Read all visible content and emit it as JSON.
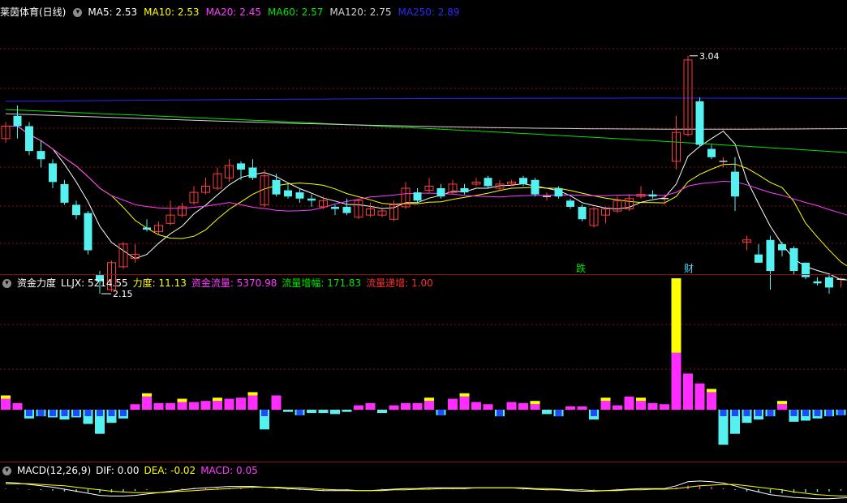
{
  "panel_price": {
    "title": "莱茵体育(日线)",
    "ma": [
      {
        "label": "MA5: 2.53",
        "color": "#ffffff"
      },
      {
        "label": "MA10: 2.53",
        "color": "#ffff00"
      },
      {
        "label": "MA20: 2.45",
        "color": "#ff3dff"
      },
      {
        "label": "MA60: 2.57",
        "color": "#00e600"
      },
      {
        "label": "MA120: 2.75",
        "color": "#d0d0d0"
      },
      {
        "label": "MA250: 2.89",
        "color": "#2a2aff"
      }
    ],
    "high_label": "3.04",
    "low_label": "2.15",
    "marks": [
      {
        "text": "跌",
        "color": "#00e600"
      },
      {
        "text": "财",
        "color": "#55d8ff"
      }
    ]
  },
  "panel_flow": {
    "title": "资金力度",
    "fields": [
      {
        "label": "LLJX: 5214.55",
        "color": "#ffffff"
      },
      {
        "label": "力度: 11.13",
        "color": "#ffff00"
      },
      {
        "label": "资金流量: 5370.98",
        "color": "#ff3dff"
      },
      {
        "label": "流量增幅: 171.83",
        "color": "#00e600"
      },
      {
        "label": "流量递增: 1.00",
        "color": "#ff3030"
      }
    ]
  },
  "panel_macd": {
    "title": "MACD(12,26,9)",
    "fields": [
      {
        "label": "DIF: 0.00",
        "color": "#ffffff"
      },
      {
        "label": "DEA: -0.02",
        "color": "#ffff00"
      },
      {
        "label": "MACD: 0.05",
        "color": "#ff3dff"
      }
    ]
  },
  "colors": {
    "up": "#ff3b3b",
    "down": "#55f0f0",
    "grid": "#8c1010",
    "flow_pos": "#ff2dff",
    "flow_pos_ext": "#ffff00",
    "flow_neg": "#55f0f0",
    "flow_neg_core": "#1e4bff"
  },
  "chart_data": {
    "type": "candlestick",
    "price_range": [
      2.0,
      3.2
    ],
    "candles": [
      [
        2.64,
        2.7,
        2.72,
        2.62
      ],
      [
        2.75,
        2.7,
        2.8,
        2.64
      ],
      [
        2.7,
        2.58,
        2.72,
        2.56
      ],
      [
        2.58,
        2.54,
        2.63,
        2.5
      ],
      [
        2.52,
        2.43,
        2.54,
        2.4
      ],
      [
        2.42,
        2.33,
        2.44,
        2.32
      ],
      [
        2.32,
        2.27,
        2.34,
        2.25
      ],
      [
        2.28,
        2.1,
        2.29,
        2.08
      ],
      [
        1.98,
        1.95,
        2.0,
        1.89
      ],
      [
        1.91,
        2.04,
        2.05,
        1.9
      ],
      [
        2.02,
        2.13,
        2.14,
        2.01
      ],
      [
        2.06,
        2.08,
        2.13,
        2.04
      ],
      [
        2.21,
        2.2,
        2.25,
        2.19
      ],
      [
        2.19,
        2.22,
        2.24,
        2.18
      ],
      [
        2.23,
        2.27,
        2.34,
        2.22
      ],
      [
        2.27,
        2.31,
        2.33,
        2.26
      ],
      [
        2.33,
        2.38,
        2.41,
        2.32
      ],
      [
        2.38,
        2.41,
        2.45,
        2.37
      ],
      [
        2.4,
        2.47,
        2.5,
        2.39
      ],
      [
        2.45,
        2.51,
        2.54,
        2.43
      ],
      [
        2.52,
        2.49,
        2.53,
        2.44
      ],
      [
        2.5,
        2.45,
        2.54,
        2.44
      ],
      [
        2.32,
        2.46,
        2.49,
        2.31
      ],
      [
        2.44,
        2.37,
        2.47,
        2.36
      ],
      [
        2.39,
        2.36,
        2.42,
        2.35
      ],
      [
        2.38,
        2.35,
        2.4,
        2.33
      ],
      [
        2.35,
        2.34,
        2.37,
        2.31
      ],
      [
        2.31,
        2.34,
        2.36,
        2.3
      ],
      [
        2.31,
        2.3,
        2.32,
        2.27
      ],
      [
        2.31,
        2.28,
        2.35,
        2.27
      ],
      [
        2.26,
        2.34,
        2.35,
        2.25
      ],
      [
        2.27,
        2.3,
        2.33,
        2.26
      ],
      [
        2.27,
        2.29,
        2.3,
        2.26
      ],
      [
        2.25,
        2.32,
        2.34,
        2.24
      ],
      [
        2.31,
        2.4,
        2.43,
        2.3
      ],
      [
        2.38,
        2.34,
        2.4,
        2.33
      ],
      [
        2.39,
        2.41,
        2.45,
        2.38
      ],
      [
        2.4,
        2.36,
        2.42,
        2.35
      ],
      [
        2.38,
        2.42,
        2.44,
        2.37
      ],
      [
        2.4,
        2.38,
        2.42,
        2.37
      ],
      [
        2.42,
        2.43,
        2.45,
        2.41
      ],
      [
        2.45,
        2.41,
        2.46,
        2.4
      ],
      [
        2.4,
        2.42,
        2.44,
        2.39
      ],
      [
        2.42,
        2.43,
        2.44,
        2.41
      ],
      [
        2.45,
        2.42,
        2.46,
        2.41
      ],
      [
        2.44,
        2.37,
        2.45,
        2.36
      ],
      [
        2.36,
        2.36,
        2.38,
        2.34
      ],
      [
        2.4,
        2.36,
        2.41,
        2.35
      ],
      [
        2.34,
        2.31,
        2.35,
        2.3
      ],
      [
        2.31,
        2.25,
        2.32,
        2.24
      ],
      [
        2.22,
        2.3,
        2.31,
        2.21
      ],
      [
        2.27,
        2.3,
        2.31,
        2.23
      ],
      [
        2.29,
        2.34,
        2.36,
        2.28
      ],
      [
        2.3,
        2.35,
        2.37,
        2.29
      ],
      [
        2.36,
        2.37,
        2.41,
        2.35
      ],
      [
        2.37,
        2.36,
        2.39,
        2.35
      ],
      [
        2.35,
        2.35,
        2.37,
        2.32
      ],
      [
        2.53,
        2.67,
        2.75,
        2.49
      ],
      [
        2.66,
        3.02,
        3.04,
        2.65
      ],
      [
        2.82,
        2.61,
        2.84,
        2.6
      ],
      [
        2.59,
        2.55,
        2.61,
        2.54
      ],
      [
        2.53,
        2.53,
        2.55,
        2.5
      ],
      [
        2.48,
        2.36,
        2.55,
        2.29
      ],
      [
        2.14,
        2.15,
        2.17,
        2.1
      ],
      [
        2.08,
        2.04,
        2.13,
        2.04
      ],
      [
        2.15,
        2.0,
        2.17,
        1.91
      ],
      [
        2.13,
        2.1,
        2.14,
        2.07
      ],
      [
        2.11,
        2.0,
        2.12,
        1.98
      ],
      [
        2.04,
        1.97,
        2.04,
        1.96
      ],
      [
        1.95,
        1.94,
        1.97,
        1.93
      ],
      [
        1.97,
        1.92,
        1.98,
        1.89
      ],
      [
        1.96,
        1.96,
        1.97,
        1.92
      ],
      [
        1.99,
        1.99,
        2.01,
        1.97
      ],
      [
        2.03,
        2.05,
        2.06,
        2.02
      ],
      [
        2.08,
        2.06,
        2.08,
        2.04
      ],
      [
        2.07,
        2.07,
        2.09,
        2.05
      ],
      [
        2.11,
        2.11,
        2.12,
        2.09
      ],
      [
        2.13,
        2.13,
        2.16,
        2.12
      ],
      [
        2.21,
        2.22,
        2.27,
        2.15
      ],
      [
        2.24,
        2.24,
        2.29,
        2.2
      ],
      [
        2.23,
        2.18,
        2.25,
        2.15
      ],
      [
        2.26,
        2.24,
        2.28,
        2.22
      ],
      [
        2.19,
        2.23,
        2.3,
        2.18
      ],
      [
        2.23,
        2.22,
        2.25,
        2.21
      ],
      [
        2.3,
        2.16,
        2.39,
        2.15
      ],
      [
        2.2,
        2.21,
        2.23,
        2.19
      ],
      [
        2.22,
        2.27,
        2.29,
        2.21
      ],
      [
        2.23,
        2.24,
        2.26,
        2.22
      ],
      [
        2.24,
        2.24,
        2.26,
        2.23
      ],
      [
        2.25,
        2.24,
        2.27,
        2.23
      ],
      [
        2.26,
        2.25,
        2.28,
        2.24
      ],
      [
        2.3,
        2.32,
        2.35,
        2.29
      ]
    ],
    "flow": [
      [
        10,
        0
      ],
      [
        6,
        0
      ],
      [
        0,
        -8
      ],
      [
        0,
        -6
      ],
      [
        0,
        -7
      ],
      [
        0,
        -9
      ],
      [
        0,
        -7
      ],
      [
        0,
        -13
      ],
      [
        0,
        -22
      ],
      [
        0,
        -12
      ],
      [
        0,
        -8
      ],
      [
        5,
        0
      ],
      [
        12,
        0
      ],
      [
        6,
        0
      ],
      [
        6,
        0
      ],
      [
        7,
        0
      ],
      [
        7,
        0
      ],
      [
        8,
        0
      ],
      [
        8,
        0
      ],
      [
        10,
        0
      ],
      [
        11,
        0
      ],
      [
        13,
        0
      ],
      [
        0,
        -18
      ],
      [
        13,
        0
      ],
      [
        0,
        -2
      ],
      [
        0,
        -5
      ],
      [
        0,
        -3
      ],
      [
        0,
        -3
      ],
      [
        0,
        -4
      ],
      [
        0,
        -2
      ],
      [
        4,
        0
      ],
      [
        6,
        0
      ],
      [
        0,
        -3
      ],
      [
        4,
        0
      ],
      [
        6,
        0
      ],
      [
        6,
        0
      ],
      [
        8,
        0
      ],
      [
        0,
        -5
      ],
      [
        10,
        0
      ],
      [
        12,
        0
      ],
      [
        7,
        0
      ],
      [
        5,
        0
      ],
      [
        0,
        -6
      ],
      [
        7,
        0
      ],
      [
        6,
        0
      ],
      [
        5,
        0
      ],
      [
        0,
        -4
      ],
      [
        0,
        -6
      ],
      [
        3,
        0
      ],
      [
        3,
        0
      ],
      [
        0,
        -9
      ],
      [
        8,
        0
      ],
      [
        4,
        0
      ],
      [
        12,
        0
      ],
      [
        8,
        0
      ],
      [
        6,
        0
      ],
      [
        5,
        0
      ],
      [
        52,
        68
      ],
      [
        33,
        0
      ],
      [
        24,
        0
      ],
      [
        16,
        0
      ],
      [
        0,
        -32
      ],
      [
        0,
        -22
      ],
      [
        0,
        -12
      ],
      [
        0,
        -9
      ],
      [
        0,
        -6
      ],
      [
        5,
        0
      ],
      [
        0,
        -11
      ],
      [
        0,
        -10
      ],
      [
        0,
        -8
      ],
      [
        0,
        -6
      ],
      [
        0,
        -5
      ],
      [
        4,
        0
      ],
      [
        5,
        0
      ],
      [
        0,
        -2
      ],
      [
        3,
        0
      ],
      [
        13,
        0
      ],
      [
        10,
        0
      ],
      [
        5,
        0
      ],
      [
        0,
        -5
      ],
      [
        6,
        0
      ],
      [
        6,
        0
      ],
      [
        4,
        0
      ],
      [
        0,
        -3
      ],
      [
        3,
        0
      ],
      [
        0,
        -2
      ],
      [
        0,
        -7
      ],
      [
        0,
        -3
      ],
      [
        0,
        -4
      ],
      [
        0,
        -3
      ],
      [
        10,
        0
      ],
      [
        18,
        0
      ],
      [
        25,
        0
      ]
    ],
    "macd": [
      [
        0.1,
        0.08,
        0.03
      ],
      [
        0.09,
        0.08,
        0.02
      ],
      [
        0.07,
        0.08,
        -0.02
      ],
      [
        0.05,
        0.07,
        -0.04
      ],
      [
        0.03,
        0.06,
        -0.06
      ],
      [
        0.0,
        0.05,
        -0.1
      ],
      [
        -0.03,
        0.03,
        -0.12
      ],
      [
        -0.06,
        0.01,
        -0.14
      ],
      [
        -0.09,
        -0.01,
        -0.16
      ],
      [
        -0.1,
        -0.03,
        -0.14
      ],
      [
        -0.1,
        -0.04,
        -0.12
      ],
      [
        -0.09,
        -0.05,
        -0.08
      ],
      [
        -0.07,
        -0.05,
        -0.04
      ],
      [
        -0.05,
        -0.05,
        0.0
      ],
      [
        -0.03,
        -0.04,
        0.02
      ],
      [
        -0.01,
        -0.03,
        0.04
      ],
      [
        0.01,
        -0.02,
        0.06
      ],
      [
        0.02,
        -0.01,
        0.06
      ],
      [
        0.03,
        0.0,
        0.06
      ],
      [
        0.04,
        0.01,
        0.06
      ],
      [
        0.04,
        0.02,
        0.04
      ],
      [
        0.04,
        0.03,
        0.02
      ],
      [
        0.03,
        0.03,
        0.0
      ],
      [
        0.02,
        0.03,
        -0.02
      ],
      [
        0.01,
        0.02,
        -0.02
      ],
      [
        0.0,
        0.02,
        -0.04
      ],
      [
        -0.01,
        0.01,
        -0.04
      ],
      [
        -0.02,
        0.0,
        -0.04
      ],
      [
        -0.02,
        -0.01,
        -0.02
      ],
      [
        -0.02,
        -0.01,
        -0.02
      ],
      [
        -0.02,
        -0.02,
        0.0
      ],
      [
        -0.02,
        -0.02,
        0.0
      ],
      [
        -0.01,
        -0.02,
        0.02
      ],
      [
        0.0,
        -0.01,
        0.02
      ],
      [
        0.01,
        -0.01,
        0.04
      ],
      [
        0.01,
        0.0,
        0.02
      ],
      [
        0.02,
        0.0,
        0.04
      ],
      [
        0.02,
        0.01,
        0.02
      ],
      [
        0.02,
        0.01,
        0.02
      ],
      [
        0.02,
        0.01,
        0.02
      ],
      [
        0.02,
        0.02,
        0.0
      ],
      [
        0.02,
        0.02,
        0.0
      ],
      [
        0.02,
        0.02,
        0.0
      ],
      [
        0.02,
        0.02,
        0.0
      ],
      [
        0.01,
        0.02,
        -0.02
      ],
      [
        0.0,
        0.01,
        -0.02
      ],
      [
        -0.01,
        0.01,
        -0.04
      ],
      [
        -0.01,
        0.0,
        -0.02
      ],
      [
        -0.02,
        -0.01,
        -0.02
      ],
      [
        -0.03,
        -0.01,
        -0.04
      ],
      [
        -0.03,
        -0.02,
        -0.02
      ],
      [
        -0.02,
        -0.02,
        0.0
      ],
      [
        -0.01,
        -0.02,
        0.02
      ],
      [
        0.0,
        -0.01,
        0.02
      ],
      [
        0.01,
        -0.01,
        0.04
      ],
      [
        0.01,
        0.0,
        0.02
      ],
      [
        0.01,
        0.0,
        0.02
      ],
      [
        0.05,
        0.01,
        0.08
      ],
      [
        0.11,
        0.03,
        0.16
      ],
      [
        0.12,
        0.05,
        0.14
      ],
      [
        0.11,
        0.06,
        0.1
      ],
      [
        0.09,
        0.07,
        0.04
      ],
      [
        0.05,
        0.07,
        -0.04
      ],
      [
        0.0,
        0.05,
        -0.1
      ],
      [
        -0.04,
        0.03,
        -0.14
      ],
      [
        -0.08,
        0.01,
        -0.18
      ],
      [
        -0.1,
        -0.01,
        -0.18
      ],
      [
        -0.12,
        -0.04,
        -0.16
      ],
      [
        -0.13,
        -0.06,
        -0.14
      ],
      [
        -0.14,
        -0.08,
        -0.12
      ],
      [
        -0.14,
        -0.09,
        -0.1
      ],
      [
        -0.13,
        -0.1,
        -0.06
      ],
      [
        -0.12,
        -0.1,
        -0.04
      ],
      [
        -0.1,
        -0.1,
        0.0
      ],
      [
        -0.08,
        -0.1,
        0.04
      ],
      [
        -0.07,
        -0.09,
        0.04
      ],
      [
        -0.05,
        -0.08,
        0.06
      ],
      [
        -0.03,
        -0.07,
        0.08
      ],
      [
        -0.01,
        -0.06,
        0.1
      ],
      [
        0.0,
        -0.05,
        0.1
      ],
      [
        0.0,
        -0.04,
        0.08
      ],
      [
        0.0,
        -0.03,
        0.06
      ],
      [
        0.01,
        -0.02,
        0.06
      ],
      [
        0.01,
        -0.02,
        0.06
      ],
      [
        0.0,
        -0.02,
        0.04
      ],
      [
        0.0,
        -0.02,
        0.04
      ],
      [
        0.0,
        -0.02,
        0.04
      ],
      [
        0.0,
        -0.02,
        0.04
      ],
      [
        0.0,
        -0.02,
        0.04
      ],
      [
        0.0,
        -0.02,
        0.04
      ],
      [
        0.0,
        -0.02,
        0.04
      ],
      [
        0.0,
        -0.02,
        0.05
      ]
    ]
  }
}
